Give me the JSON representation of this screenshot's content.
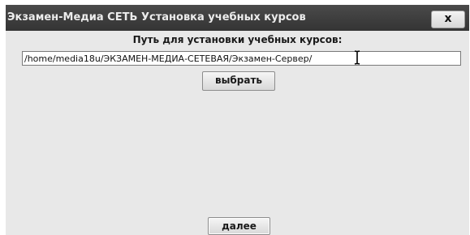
{
  "window": {
    "app_title": "Экзамен-Медиа СЕТЬ",
    "dialog_title": "Установка учебных курсов",
    "close_label": "x"
  },
  "form": {
    "path_label": "Путь для установки учебных курсов:",
    "path_value": "/home/media18u/ЭКЗАМЕН-МЕДИА-СЕТЕВАЯ/Экзамен-Сервер/",
    "choose_button": "выбрать",
    "next_button": "далее"
  },
  "icons": {
    "text_cursor": "text-cursor-icon"
  }
}
